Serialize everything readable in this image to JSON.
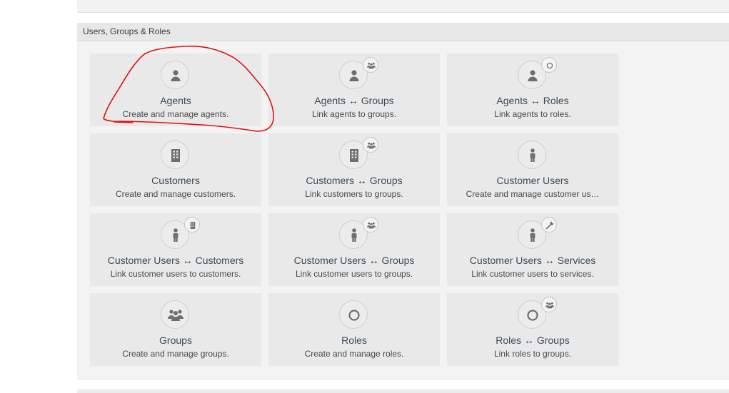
{
  "section": {
    "title": "Users, Groups & Roles"
  },
  "tiles": [
    {
      "title": "Agents",
      "desc": "Create and manage agents.",
      "icon": "agent-icon",
      "badge": ""
    },
    {
      "title": "Agents ↔ Groups",
      "desc": "Link agents to groups.",
      "icon": "agent-icon",
      "badge": "group-icon"
    },
    {
      "title": "Agents ↔ Roles",
      "desc": "Link agents to roles.",
      "icon": "agent-icon",
      "badge": "role-icon"
    },
    {
      "title": "Customers",
      "desc": "Create and manage customers.",
      "icon": "building-icon",
      "badge": ""
    },
    {
      "title": "Customers ↔ Groups",
      "desc": "Link customers to groups.",
      "icon": "building-icon",
      "badge": "group-icon"
    },
    {
      "title": "Customer Users",
      "desc": "Create and manage customer us…",
      "icon": "customer-user-icon",
      "badge": ""
    },
    {
      "title": "Customer Users ↔ Customers",
      "desc": "Link customer users to customers.",
      "icon": "customer-user-icon",
      "badge": "building-icon"
    },
    {
      "title": "Customer Users ↔ Groups",
      "desc": "Link customer users to groups.",
      "icon": "customer-user-icon",
      "badge": "group-icon"
    },
    {
      "title": "Customer Users ↔ Services",
      "desc": "Link customer users to services.",
      "icon": "customer-user-icon",
      "badge": "wrench-icon"
    },
    {
      "title": "Groups",
      "desc": "Create and manage groups.",
      "icon": "group-icon",
      "badge": ""
    },
    {
      "title": "Roles",
      "desc": "Create and manage roles.",
      "icon": "role-icon",
      "badge": ""
    },
    {
      "title": "Roles ↔ Groups",
      "desc": "Link roles to groups.",
      "icon": "role-icon",
      "badge": "group-icon"
    }
  ],
  "colors": {
    "icon": "#6f6f6f",
    "annotation": "#e01010"
  }
}
